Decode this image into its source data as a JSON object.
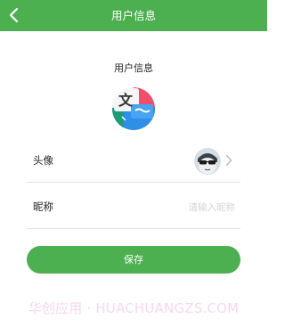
{
  "header": {
    "title": "用户信息",
    "back_icon": "chevron-left-icon"
  },
  "profile": {
    "section_title": "用户信息",
    "logo_icon": "translate-app-logo-icon",
    "logo_glyph": "文",
    "avatar_row_label": "头像",
    "avatar_icon": "user-avatar-icon",
    "nickname_row_label": "昵称",
    "nickname_placeholder": "请输入昵称",
    "nickname_value": ""
  },
  "actions": {
    "save_label": "保存"
  },
  "watermark": {
    "text": "华创应用 · HUACHUANGZS.COM"
  },
  "colors": {
    "primary": "#4caf50",
    "header_text": "#ffffff",
    "divider": "#e2e2e2",
    "placeholder": "#d4d4d4"
  }
}
